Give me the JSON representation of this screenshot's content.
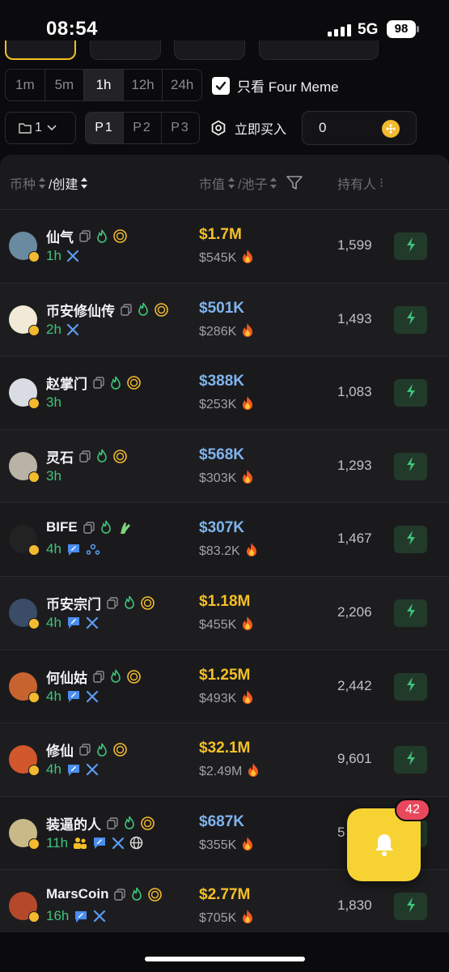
{
  "status": {
    "time": "08:54",
    "network": "5G",
    "battery": "98"
  },
  "time_filters": [
    "1m",
    "5m",
    "1h",
    "12h",
    "24h"
  ],
  "time_active": "1h",
  "four_meme": {
    "label": "只看 Four Meme",
    "checked": true
  },
  "page_select": "1",
  "presets": [
    "P1",
    "P2",
    "P3"
  ],
  "preset_active": "P1",
  "buy_now": {
    "label": "立即买入",
    "amount": "0"
  },
  "columns": {
    "token": "币种",
    "created": "/创建",
    "mcap": "市值",
    "pool": "/池子",
    "holders": "持有人"
  },
  "colors": {
    "gold": "#f5c024",
    "blue": "#7fb4ee",
    "green": "#3fc47a",
    "quick_bg": "#223a2a",
    "bell": "#f7d233"
  },
  "rows": [
    {
      "name": "仙气",
      "age": "1h",
      "mcap": "$1.7M",
      "mcap_color": "gold",
      "pool": "$545K",
      "holders": "1,599",
      "name_icons": [
        "copy-icon",
        "flame-icon",
        "coin-icon"
      ],
      "links": [
        "x-icon"
      ],
      "avatar_color": "#6a8aa0"
    },
    {
      "name": "币安修仙传",
      "age": "2h",
      "mcap": "$501K",
      "mcap_color": "blue",
      "pool": "$286K",
      "holders": "1,493",
      "name_icons": [
        "copy-icon",
        "flame-icon",
        "coin-icon"
      ],
      "links": [
        "x-icon"
      ],
      "avatar_color": "#f2ead6"
    },
    {
      "name": "赵掌门",
      "age": "3h",
      "mcap": "$388K",
      "mcap_color": "blue",
      "pool": "$253K",
      "holders": "1,083",
      "name_icons": [
        "copy-icon",
        "flame-icon",
        "coin-icon"
      ],
      "links": [],
      "avatar_color": "#d9dde3"
    },
    {
      "name": "灵石",
      "age": "3h",
      "mcap": "$568K",
      "mcap_color": "blue",
      "pool": "$303K",
      "holders": "1,293",
      "name_icons": [
        "copy-icon",
        "flame-icon",
        "coin-icon"
      ],
      "links": [],
      "avatar_color": "#b9b3a6"
    },
    {
      "name": "BIFE",
      "age": "4h",
      "mcap": "$307K",
      "mcap_color": "blue",
      "pool": "$83.2K",
      "holders": "1,467",
      "name_icons": [
        "copy-icon",
        "flame-icon",
        "pray-icon"
      ],
      "links": [
        "chat-icon",
        "community-icon"
      ],
      "avatar_color": "#222"
    },
    {
      "name": "币安宗门",
      "age": "4h",
      "mcap": "$1.18M",
      "mcap_color": "gold",
      "pool": "$455K",
      "holders": "2,206",
      "name_icons": [
        "copy-icon",
        "flame-icon",
        "coin-icon"
      ],
      "links": [
        "chat-icon",
        "x-icon"
      ],
      "avatar_color": "#3a4c66"
    },
    {
      "name": "何仙姑",
      "age": "4h",
      "mcap": "$1.25M",
      "mcap_color": "gold",
      "pool": "$493K",
      "holders": "2,442",
      "name_icons": [
        "copy-icon",
        "flame-icon",
        "coin-icon"
      ],
      "links": [
        "chat-icon",
        "x-icon"
      ],
      "avatar_color": "#c7632f"
    },
    {
      "name": "修仙",
      "age": "4h",
      "mcap": "$32.1M",
      "mcap_color": "gold",
      "pool": "$2.49M",
      "holders": "9,601",
      "name_icons": [
        "copy-icon",
        "flame-icon",
        "coin-icon"
      ],
      "links": [
        "chat-icon",
        "x-icon"
      ],
      "avatar_color": "#d2572c"
    },
    {
      "name": "装逼的人",
      "age": "11h",
      "mcap": "$687K",
      "mcap_color": "blue",
      "pool": "$355K",
      "holders": "5",
      "name_icons": [
        "copy-icon",
        "flame-icon",
        "coin-icon"
      ],
      "links": [
        "people-icon",
        "chat-icon",
        "x-icon",
        "globe-icon"
      ],
      "avatar_color": "#c9b988"
    },
    {
      "name": "MarsCoin",
      "age": "16h",
      "mcap": "$2.77M",
      "mcap_color": "gold",
      "pool": "$705K",
      "holders": "1,830",
      "name_icons": [
        "copy-icon",
        "flame-icon",
        "coin-icon"
      ],
      "links": [
        "chat-icon",
        "x-icon"
      ],
      "avatar_color": "#b5482a"
    }
  ],
  "notifications": {
    "count": "42"
  }
}
